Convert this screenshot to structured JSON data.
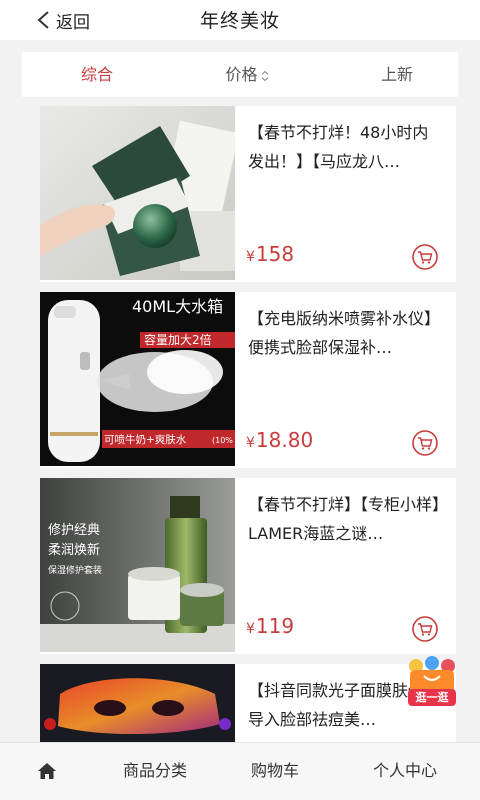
{
  "header": {
    "back_label": "返回",
    "title": "年终美妆"
  },
  "sort": {
    "tabs": [
      {
        "label": "综合",
        "active": true
      },
      {
        "label": "价格",
        "active": false
      },
      {
        "label": "上新",
        "active": false
      }
    ]
  },
  "products": [
    {
      "name": "【春节不打烊！48小时内发出！】【马应龙八…",
      "currency": "¥",
      "price": "158",
      "image_text": []
    },
    {
      "name": "【充电版纳米喷雾补水仪】便携式脸部保湿补…",
      "currency": "¥",
      "price": "18.80",
      "image_text": [
        "40ML大水箱",
        "容量加大2倍",
        "可喷牛奶+爽肤水",
        "(10%"
      ]
    },
    {
      "name": "【春节不打烊】【专柜小样】LAMER海蓝之谜…",
      "currency": "¥",
      "price": "119",
      "image_text": [
        "修护经典",
        "柔润焕新",
        "保湿修护套装"
      ]
    },
    {
      "name": "【抖音同款光子面膜肤仪】导入脸部祛痘美…",
      "currency": "¥",
      "price": "",
      "image_text": []
    }
  ],
  "fab": {
    "label": "逛一逛"
  },
  "bottom_nav": {
    "home_icon": "home-icon",
    "category": "商品分类",
    "cart": "购物车",
    "profile": "个人中心"
  },
  "colors": {
    "accent": "#c83c3c"
  }
}
